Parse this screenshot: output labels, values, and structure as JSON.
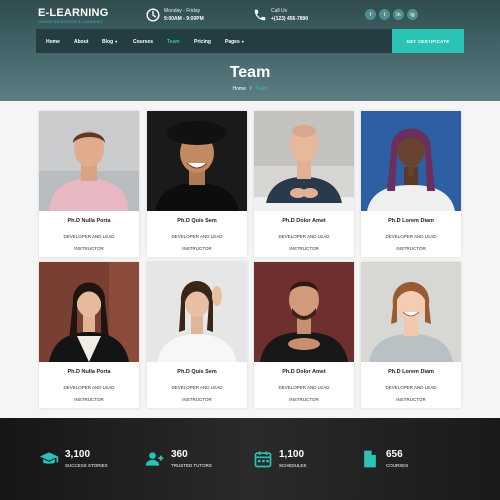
{
  "brand": {
    "name": "E-LEARNING",
    "tagline": "ONLINE EDUCATION & LEARNING"
  },
  "topbar": {
    "hours": {
      "label": "Monday - Friday",
      "value": "9:00AM - 9:00PM",
      "icon": "clock-icon"
    },
    "call": {
      "label": "Call Us",
      "value": "+(123) 456-7890",
      "icon": "phone-icon"
    },
    "socials": [
      "f",
      "t",
      "in",
      "ig"
    ]
  },
  "nav": {
    "items": [
      "Home",
      "About",
      "Blog",
      "Courses",
      "Team",
      "Pricing",
      "Pages"
    ],
    "active": "Team",
    "cta": "GET CERTIFICATE"
  },
  "hero": {
    "title": "Team",
    "breadcrumb_home": "Home",
    "breadcrumb_sep": "/",
    "breadcrumb_current": "Team"
  },
  "team": [
    {
      "name": "Ph.D Nulla Porta",
      "role1": "DEVELOPER AND LEAD",
      "role2": "INSTRUCTOR"
    },
    {
      "name": "Ph.D Quis Sem",
      "role1": "DEVELOPER AND LEAD",
      "role2": "INSTRUCTOR"
    },
    {
      "name": "Ph.D Dolor Amet",
      "role1": "DEVELOPER AND LEAD",
      "role2": "INSTRUCTOR"
    },
    {
      "name": "Ph.D Lorem Diam",
      "role1": "DEVELOPER AND LEAD",
      "role2": "INSTRUCTOR"
    },
    {
      "name": "Ph.D Nulla Porta",
      "role1": "DEVELOPER AND LEAD",
      "role2": "INSTRUCTOR"
    },
    {
      "name": "Ph.D Quis Sem",
      "role1": "DEVELOPER AND LEAD",
      "role2": "INSTRUCTOR"
    },
    {
      "name": "Ph.D Dolor Amet",
      "role1": "DEVELOPER AND LEAD",
      "role2": "INSTRUCTOR"
    },
    {
      "name": "Ph.D Lorem Diam",
      "role1": "DEVELOPER AND LEAD",
      "role2": "INSTRUCTOR"
    }
  ],
  "stats": [
    {
      "value": "3,100",
      "label": "SUCCESS STORIES",
      "icon": "graduation-cap-icon"
    },
    {
      "value": "360",
      "label": "TRUSTED TUTORS",
      "icon": "user-plus-icon"
    },
    {
      "value": "1,100",
      "label": "SCHEDULES",
      "icon": "calendar-icon"
    },
    {
      "value": "656",
      "label": "COURSES",
      "icon": "document-icon"
    }
  ],
  "colors": {
    "accent": "#2bc3b5",
    "nav_bg": "#243d40",
    "hero_bg": "#3f6165",
    "stats_bg": "#1f1f1f"
  }
}
